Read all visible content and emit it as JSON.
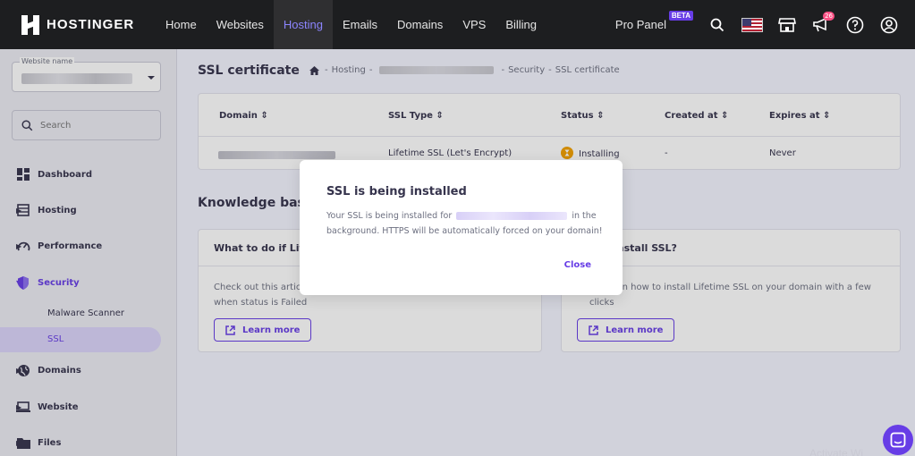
{
  "brand": {
    "name": "HOSTINGER"
  },
  "topnav": {
    "items": [
      {
        "label": "Home"
      },
      {
        "label": "Websites"
      },
      {
        "label": "Hosting"
      },
      {
        "label": "Emails"
      },
      {
        "label": "Domains"
      },
      {
        "label": "VPS"
      },
      {
        "label": "Billing"
      }
    ],
    "active": "Hosting",
    "pro_panel": "Pro Panel",
    "beta": "BETA",
    "notifications_count": "26"
  },
  "sidebar": {
    "website_name_label": "Website name",
    "search_placeholder": "Search",
    "items": [
      {
        "label": "Dashboard",
        "icon": "dashboard-icon"
      },
      {
        "label": "Hosting",
        "icon": "server-icon"
      },
      {
        "label": "Performance",
        "icon": "speedometer-icon"
      },
      {
        "label": "Security",
        "icon": "shield-icon"
      },
      {
        "label": "Domains",
        "icon": "globe-icon"
      },
      {
        "label": "Website",
        "icon": "laptop-icon"
      },
      {
        "label": "Files",
        "icon": "folder-icon"
      }
    ],
    "security_sub": [
      {
        "label": "Malware Scanner"
      },
      {
        "label": "SSL"
      }
    ]
  },
  "page": {
    "title": "SSL certificate",
    "breadcrumb": {
      "hosting": "Hosting",
      "security": "Security",
      "current": "SSL certificate",
      "sep": "-"
    }
  },
  "ssl_table": {
    "columns": [
      {
        "label": "Domain"
      },
      {
        "label": "SSL Type"
      },
      {
        "label": "Status"
      },
      {
        "label": "Created at"
      },
      {
        "label": "Expires at"
      }
    ],
    "row": {
      "ssl_type": "Lifetime SSL (Let's Encrypt)",
      "status": "Installing",
      "created_at": "-",
      "expires_at": "Never"
    }
  },
  "knowledge_base": {
    "title": "Knowledge base",
    "cards": [
      {
        "title": "What to do if Life",
        "text": "Check out this article",
        "text2": "when status is Failed",
        "button": "Learn more"
      },
      {
        "title": "install SSL?",
        "text": "video on how to install Lifetime SSL on your domain with a few",
        "text2": "clicks",
        "button": "Learn more"
      }
    ]
  },
  "modal": {
    "title": "SSL is being installed",
    "body_before": "Your SSL is being installed for",
    "body_after": "in the background. HTTPS will be automatically forced on your domain!",
    "close": "Close"
  },
  "colors": {
    "accent": "#673de6",
    "topbar_bg": "#1d1e20",
    "page_bg": "#f4f5ff",
    "status_warning": "#f2a000"
  },
  "watermark": "Activate Wi"
}
